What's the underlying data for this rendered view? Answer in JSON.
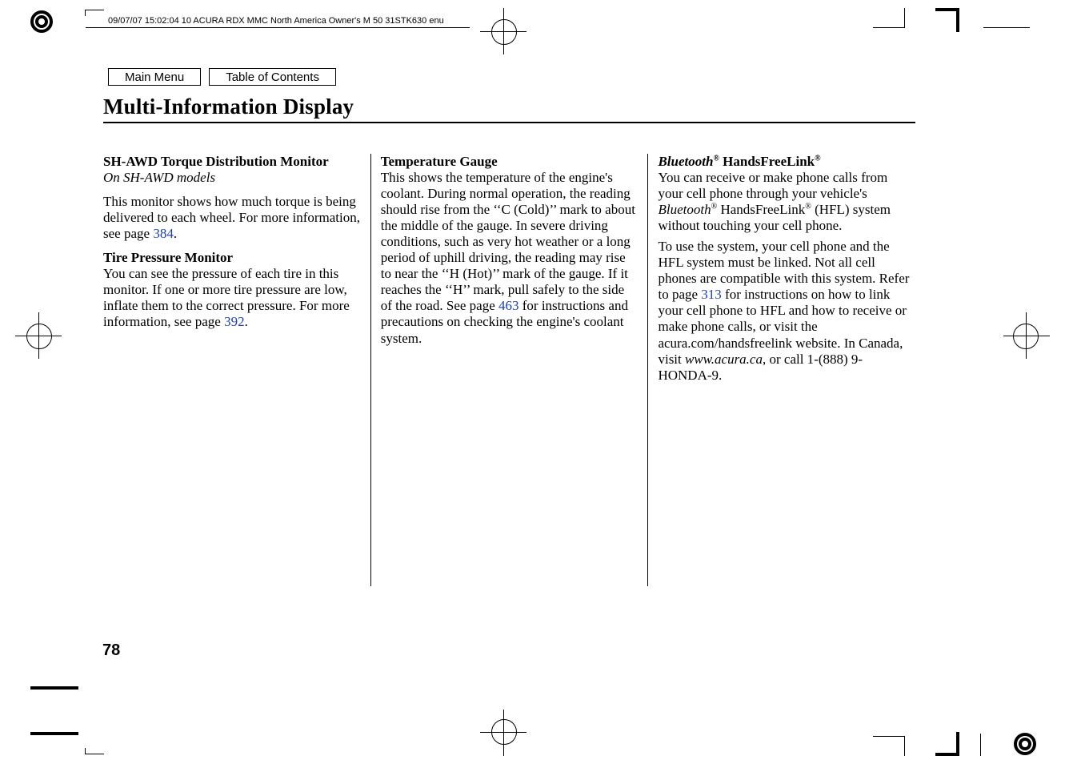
{
  "meta": {
    "header_line": "09/07/07 15:02:04   10 ACURA RDX MMC North America Owner's M 50 31STK630 enu"
  },
  "nav": {
    "main_menu": "Main Menu",
    "toc": "Table of Contents"
  },
  "title": "Multi-Information Display",
  "page_number": "78",
  "col1": {
    "h1": "SH-AWD Torque Distribution Monitor",
    "h1_sub": "On SH-AWD models",
    "p1_a": "This monitor shows how much torque is being delivered to each wheel. For more information, see page ",
    "p1_link": "384",
    "p1_b": ".",
    "h2": "Tire Pressure Monitor",
    "p2_a": "You can see the pressure of each tire in this monitor. If one or more tire pressure are low, inflate them to the correct pressure. For more information, see page ",
    "p2_link": "392",
    "p2_b": "."
  },
  "col2": {
    "h1": "Temperature Gauge",
    "p1_a": "This shows the temperature of the engine's coolant. During normal operation, the reading should rise from the ‘‘C (Cold)’’ mark to about the middle of the gauge. In severe driving conditions, such as very hot weather or a long period of uphill driving, the reading may rise to near the ‘‘H (Hot)’’ mark of the gauge. If it reaches the ‘‘H’’ mark, pull safely to the side of the road. See page ",
    "p1_link": "463",
    "p1_b": " for instructions and precautions on checking the engine's coolant system."
  },
  "col3": {
    "h1_a": "Bluetooth",
    "h1_sup1": "®",
    "h1_b": " HandsFreeLink",
    "h1_sup2": "®",
    "p1_a": "You can receive or make phone calls from your cell phone through your vehicle's ",
    "p1_it": "Bluetooth",
    "p1_sup1": "®",
    "p1_b": " HandsFreeLink",
    "p1_sup2": "®",
    "p1_c": " (HFL) system without touching your cell phone.",
    "p2_a": "To use the system, your cell phone and the HFL system must be linked. Not all cell phones are compatible with this system. Refer to page ",
    "p2_link": "313",
    "p2_b": " for instructions on how to link your cell phone to HFL and how to receive or make phone calls, or visit the acura.com/handsfreelink website. In Canada, visit ",
    "p2_it": "www.acura.ca",
    "p2_c": ", or call 1-(888) 9-HONDA-9."
  }
}
